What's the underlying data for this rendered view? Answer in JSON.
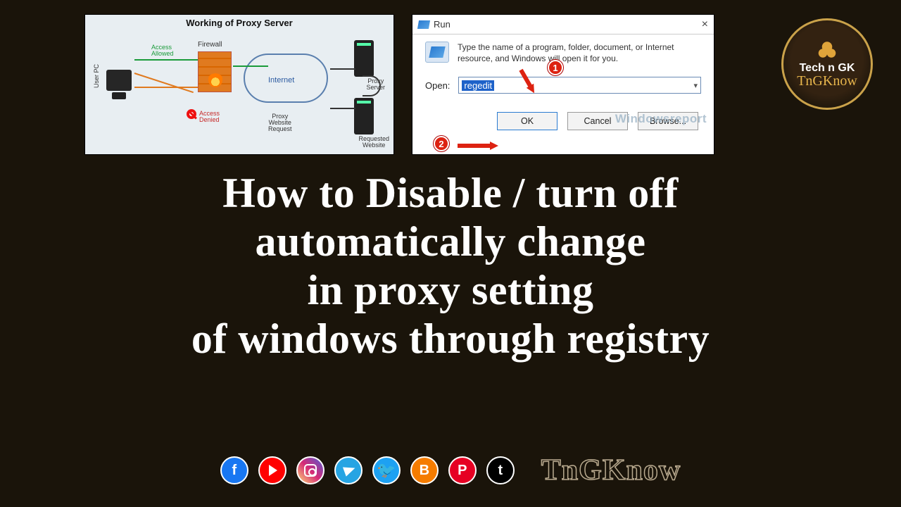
{
  "proxy_diagram": {
    "title": "Working of Proxy Server",
    "user_pc": "User PC",
    "firewall": "Firewall",
    "internet": "Internet",
    "proxy_server": "Proxy\nServer",
    "requested_website": "Requested\nWebsite",
    "proxy_request": "Proxy\nWebsite\nRequest",
    "access_allowed": "Access\nAllowed",
    "access_denied": "Access\nDenied"
  },
  "run_dialog": {
    "title": "Run",
    "close": "×",
    "description": "Type the name of a program, folder, document, or Internet resource, and Windows will open it for you.",
    "open_label": "Open:",
    "input_value": "regedit",
    "ok": "OK",
    "cancel": "Cancel",
    "browse": "Browse...",
    "badge1": "1",
    "badge2": "2",
    "watermark": "Windowsreport"
  },
  "channel_logo": {
    "line1": "Tech n GK",
    "line2": "TnGKnow"
  },
  "main_title": {
    "l1": "How to Disable / turn off",
    "l2": "automatically change",
    "l3": "in proxy setting",
    "l4": "of windows through registry"
  },
  "social": {
    "facebook": "f",
    "blogger": "B",
    "pinterest": "P",
    "tumblr": "t",
    "brand": "TnGKnow"
  }
}
